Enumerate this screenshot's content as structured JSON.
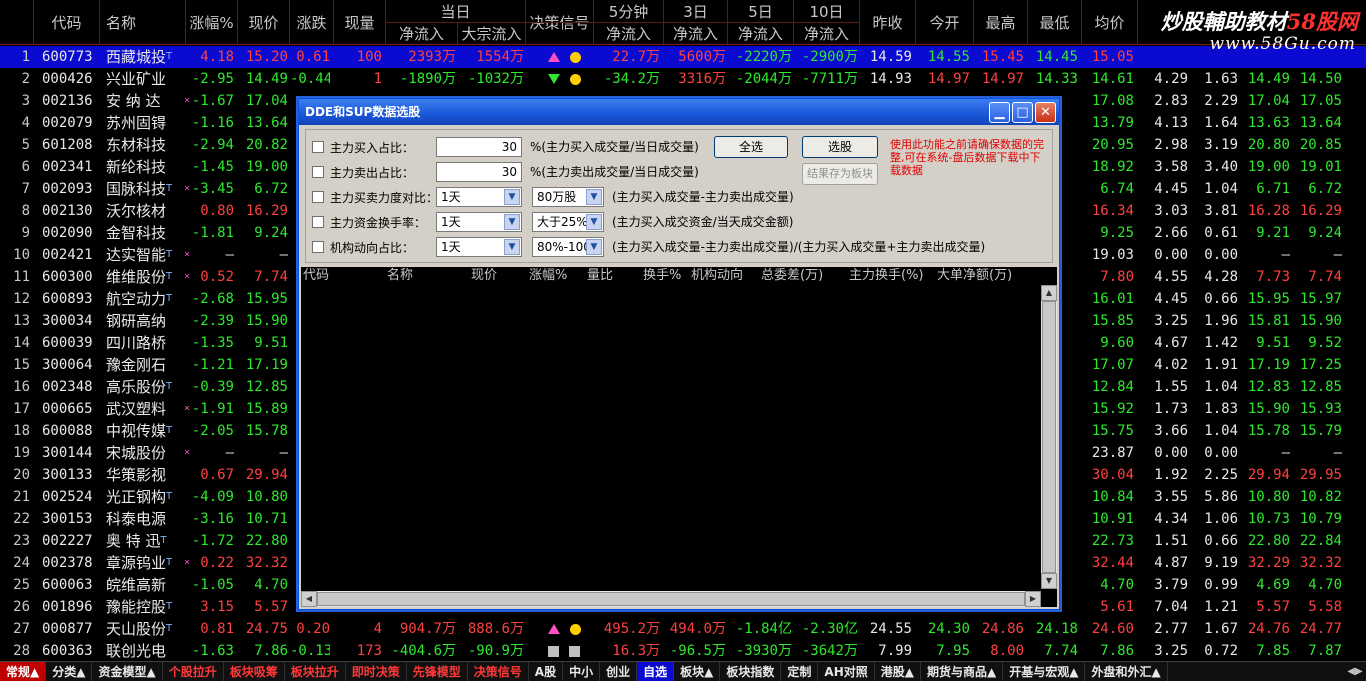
{
  "header": {
    "cols": [
      "代码",
      "名称",
      "涨幅%",
      "现价",
      "涨跌",
      "现量",
      "决策信号",
      "昨收",
      "今开",
      "最高",
      "最低",
      "均价"
    ],
    "dangri": "当日",
    "jingliuru": "净流入",
    "dazong": "大宗流入",
    "m5": "5分钟",
    "d3": "3日",
    "d5": "5日",
    "d10": "10日"
  },
  "logo": {
    "line1a": "炒股輔助教材",
    "line1b": "58股网",
    "line2": "www.58Gu.com"
  },
  "rows": [
    {
      "i": "1",
      "code": "600773",
      "name": "西藏城投",
      "sup": "T",
      "star": "",
      "chg": "4.18",
      "price": "15.20",
      "diff": "0.61",
      "vol": "100",
      "jl": "2393万",
      "dz": "1554万",
      "sig": "up",
      "m5": "22.7万",
      "d3": "5600万",
      "d5": "-2220万",
      "d10": "-2900万",
      "zs": "14.59",
      "jk": "14.55",
      "zg": "15.45",
      "zd": "14.45",
      "jj": "15.05",
      "e1": "",
      "e2": "",
      "e3": "",
      "e4": ""
    },
    {
      "i": "2",
      "code": "000426",
      "name": "兴业矿业",
      "sup": "",
      "star": "",
      "chg": "-2.95",
      "price": "14.49",
      "diff": "-0.44",
      "vol": "1",
      "jl": "-1890万",
      "dz": "-1032万",
      "sig": "dn",
      "m5": "-34.2万",
      "d3": "3316万",
      "d5": "-2044万",
      "d10": "-7711万",
      "zs": "14.93",
      "jk": "14.97",
      "zg": "14.97",
      "zd": "14.33",
      "jj": "14.61",
      "e1": "4.29",
      "e2": "1.63",
      "e3": "14.49",
      "e4": "14.50"
    },
    {
      "i": "3",
      "code": "002136",
      "name": "安 纳 达",
      "sup": "",
      "star": "×",
      "chg": "-1.67",
      "price": "17.04",
      "diff": "",
      "vol": "",
      "jl": "",
      "dz": "",
      "sig": "",
      "m5": "",
      "d3": "",
      "d5": "",
      "d10": "",
      "zs": "",
      "jk": "",
      "zg": "",
      "zd": "",
      "jj": "17.08",
      "e1": "2.83",
      "e2": "2.29",
      "e3": "17.04",
      "e4": "17.05"
    },
    {
      "i": "4",
      "code": "002079",
      "name": "苏州固锝",
      "sup": "",
      "star": "",
      "chg": "-1.16",
      "price": "13.64",
      "jj": "13.79",
      "e1": "4.13",
      "e2": "1.64",
      "e3": "13.63",
      "e4": "13.64"
    },
    {
      "i": "5",
      "code": "601208",
      "name": "东材科技",
      "sup": "",
      "star": "",
      "chg": "-2.94",
      "price": "20.82",
      "jj": "20.95",
      "e1": "2.98",
      "e2": "3.19",
      "e3": "20.80",
      "e4": "20.85"
    },
    {
      "i": "6",
      "code": "002341",
      "name": "新纶科技",
      "sup": "",
      "star": "",
      "chg": "-1.45",
      "price": "19.00",
      "jj": "18.92",
      "e1": "3.58",
      "e2": "3.40",
      "e3": "19.00",
      "e4": "19.01"
    },
    {
      "i": "7",
      "code": "002093",
      "name": "国脉科技",
      "sup": "T",
      "star": "×",
      "chg": "-3.45",
      "price": "6.72",
      "jj": "6.74",
      "e1": "4.45",
      "e2": "1.04",
      "e3": "6.71",
      "e4": "6.72"
    },
    {
      "i": "8",
      "code": "002130",
      "name": "沃尔核材",
      "sup": "",
      "star": "",
      "chg": "0.80",
      "price": "16.29",
      "jj": "16.34",
      "e1": "3.03",
      "e2": "3.81",
      "e3": "16.28",
      "e4": "16.29"
    },
    {
      "i": "9",
      "code": "002090",
      "name": "金智科技",
      "sup": "",
      "star": "",
      "chg": "-1.81",
      "price": "9.24",
      "jj": "9.25",
      "e1": "2.66",
      "e2": "0.61",
      "e3": "9.21",
      "e4": "9.24"
    },
    {
      "i": "10",
      "code": "002421",
      "name": "达实智能",
      "sup": "T",
      "star": "×",
      "chg": "—",
      "price": "—",
      "jj": "19.03",
      "e1": "0.00",
      "e2": "0.00",
      "e3": "—",
      "e4": "—"
    },
    {
      "i": "11",
      "code": "600300",
      "name": "维维股份",
      "sup": "T",
      "star": "×",
      "chg": "0.52",
      "price": "7.74",
      "jj": "7.80",
      "e1": "4.55",
      "e2": "4.28",
      "e3": "7.73",
      "e4": "7.74"
    },
    {
      "i": "12",
      "code": "600893",
      "name": "航空动力",
      "sup": "T",
      "star": "",
      "chg": "-2.68",
      "price": "15.95",
      "jj": "16.01",
      "e1": "4.45",
      "e2": "0.66",
      "e3": "15.95",
      "e4": "15.97"
    },
    {
      "i": "13",
      "code": "300034",
      "name": "钢研高纳",
      "sup": "",
      "star": "",
      "chg": "-2.39",
      "price": "15.90",
      "jj": "15.85",
      "e1": "3.25",
      "e2": "1.96",
      "e3": "15.81",
      "e4": "15.90"
    },
    {
      "i": "14",
      "code": "600039",
      "name": "四川路桥",
      "sup": "",
      "star": "",
      "chg": "-1.35",
      "price": "9.51",
      "jj": "9.60",
      "e1": "4.67",
      "e2": "1.42",
      "e3": "9.51",
      "e4": "9.52"
    },
    {
      "i": "15",
      "code": "300064",
      "name": "豫金刚石",
      "sup": "",
      "star": "",
      "chg": "-1.21",
      "price": "17.19",
      "jj": "17.07",
      "e1": "4.02",
      "e2": "1.91",
      "e3": "17.19",
      "e4": "17.25"
    },
    {
      "i": "16",
      "code": "002348",
      "name": "高乐股份",
      "sup": "T",
      "star": "",
      "chg": "-0.39",
      "price": "12.85",
      "jj": "12.84",
      "e1": "1.55",
      "e2": "1.04",
      "e3": "12.83",
      "e4": "12.85"
    },
    {
      "i": "17",
      "code": "000665",
      "name": "武汉塑料",
      "sup": "",
      "star": "×",
      "chg": "-1.91",
      "price": "15.89",
      "jj": "15.92",
      "e1": "1.73",
      "e2": "1.83",
      "e3": "15.90",
      "e4": "15.93"
    },
    {
      "i": "18",
      "code": "600088",
      "name": "中视传媒",
      "sup": "T",
      "star": "",
      "chg": "-2.05",
      "price": "15.78",
      "jj": "15.75",
      "e1": "3.66",
      "e2": "1.04",
      "e3": "15.78",
      "e4": "15.79"
    },
    {
      "i": "19",
      "code": "300144",
      "name": "宋城股份",
      "sup": "",
      "star": "×",
      "chg": "—",
      "price": "—",
      "jj": "23.87",
      "e1": "0.00",
      "e2": "0.00",
      "e3": "—",
      "e4": "—"
    },
    {
      "i": "20",
      "code": "300133",
      "name": "华策影视",
      "sup": "",
      "star": "",
      "chg": "0.67",
      "price": "29.94",
      "jj": "30.04",
      "e1": "1.92",
      "e2": "2.25",
      "e3": "29.94",
      "e4": "29.95"
    },
    {
      "i": "21",
      "code": "002524",
      "name": "光正钢构",
      "sup": "T",
      "star": "",
      "chg": "-4.09",
      "price": "10.80",
      "jj": "10.84",
      "e1": "3.55",
      "e2": "5.86",
      "e3": "10.80",
      "e4": "10.82"
    },
    {
      "i": "22",
      "code": "300153",
      "name": "科泰电源",
      "sup": "",
      "star": "",
      "chg": "-3.16",
      "price": "10.71",
      "jj": "10.91",
      "e1": "4.34",
      "e2": "1.06",
      "e3": "10.73",
      "e4": "10.79"
    },
    {
      "i": "23",
      "code": "002227",
      "name": "奥 特 迅",
      "sup": "T",
      "star": "",
      "chg": "-1.72",
      "price": "22.80",
      "jj": "22.73",
      "e1": "1.51",
      "e2": "0.66",
      "e3": "22.80",
      "e4": "22.84"
    },
    {
      "i": "24",
      "code": "002378",
      "name": "章源钨业",
      "sup": "T",
      "star": "×",
      "chg": "0.22",
      "price": "32.32",
      "jj": "32.44",
      "e1": "4.87",
      "e2": "9.19",
      "e3": "32.29",
      "e4": "32.32"
    },
    {
      "i": "25",
      "code": "600063",
      "name": "皖维高新",
      "sup": "",
      "star": "",
      "chg": "-1.05",
      "price": "4.70",
      "jj": "4.70",
      "e1": "3.79",
      "e2": "0.99",
      "e3": "4.69",
      "e4": "4.70"
    },
    {
      "i": "26",
      "code": "001896",
      "name": "豫能控股",
      "sup": "T",
      "star": "",
      "chg": "3.15",
      "price": "5.57",
      "jj": "5.61",
      "e1": "7.04",
      "e2": "1.21",
      "e3": "5.57",
      "e4": "5.58"
    },
    {
      "i": "27",
      "code": "000877",
      "name": "天山股份",
      "sup": "T",
      "star": "",
      "chg": "0.81",
      "price": "24.75",
      "diff": "0.20",
      "vol": "4",
      "jl": "904.7万",
      "dz": "888.6万",
      "sig": "up",
      "m5": "495.2万",
      "d3": "494.0万",
      "d5": "-1.84亿",
      "d10": "-2.30亿",
      "zs": "24.55",
      "jk": "24.30",
      "zg": "24.86",
      "zd": "24.18",
      "jj": "24.60",
      "e1": "2.77",
      "e2": "1.67",
      "e3": "24.76",
      "e4": "24.77"
    },
    {
      "i": "28",
      "code": "600363",
      "name": "联创光电",
      "sup": "",
      "star": "",
      "chg": "-1.63",
      "price": "7.86",
      "diff": "-0.13",
      "vol": "173",
      "jl": "-404.6万",
      "dz": "-90.9万",
      "sig": "sq",
      "m5": "16.3万",
      "d3": "-96.5万",
      "d5": "-3930万",
      "d10": "-3642万",
      "zs": "7.99",
      "jk": "7.95",
      "zg": "8.00",
      "zd": "7.74",
      "jj": "7.86",
      "e1": "3.25",
      "e2": "0.72",
      "e3": "7.85",
      "e4": "7.87"
    }
  ],
  "dialog": {
    "title": "DDE和SUP数据选股",
    "opts": [
      {
        "label": "主力买入占比：",
        "value": "30",
        "desc": "%(主力买入成交量/当日成交量)"
      },
      {
        "label": "主力卖出占比：",
        "value": "30",
        "desc": "%(主力卖出成交量/当日成交量)"
      },
      {
        "label": "主力买卖力度对比：",
        "sel1": "1天",
        "sel2": "80万股",
        "desc": "(主力买入成交量-主力卖出成交量)"
      },
      {
        "label": "主力资金换手率：",
        "sel1": "1天",
        "sel2": "大于25%",
        "desc": "(主力买入成交资金/当天成交金额)"
      },
      {
        "label": "机构动向占比：",
        "sel1": "1天",
        "sel2": "80%-100%",
        "desc": "(主力买入成交量-主力卖出成交量)/(主力买入成交量+主力卖出成交量)"
      }
    ],
    "btn_all": "全选",
    "btn_pick": "选股",
    "btn_save": "结果存为板块",
    "warn": "使用此功能之前请确保数据的完整,可在系统-盘后数据下载中下载数据",
    "list_cols": [
      "代码",
      "名称",
      "现价",
      "涨幅%",
      "量比",
      "换手%",
      "机构动向",
      "总委差(万)",
      "主力换手(%)",
      "大单净额(万)"
    ]
  },
  "tabs": [
    "常规▲",
    "分类▲",
    "资金模型▲",
    "个股拉升",
    "板块吸筹",
    "板块拉升",
    "即时决策",
    "先锋模型",
    "决策信号",
    "A股",
    "中小",
    "创业",
    "自选",
    "板块▲",
    "板块指数",
    "定制",
    "AH对照",
    "港股▲",
    "期货与商品▲",
    "开基与宏观▲",
    "外盘和外汇▲"
  ],
  "colors": {
    "up": "#ff4040",
    "down": "#2ee82e",
    "select": "#0a0ad0",
    "accent": "#c00000"
  }
}
